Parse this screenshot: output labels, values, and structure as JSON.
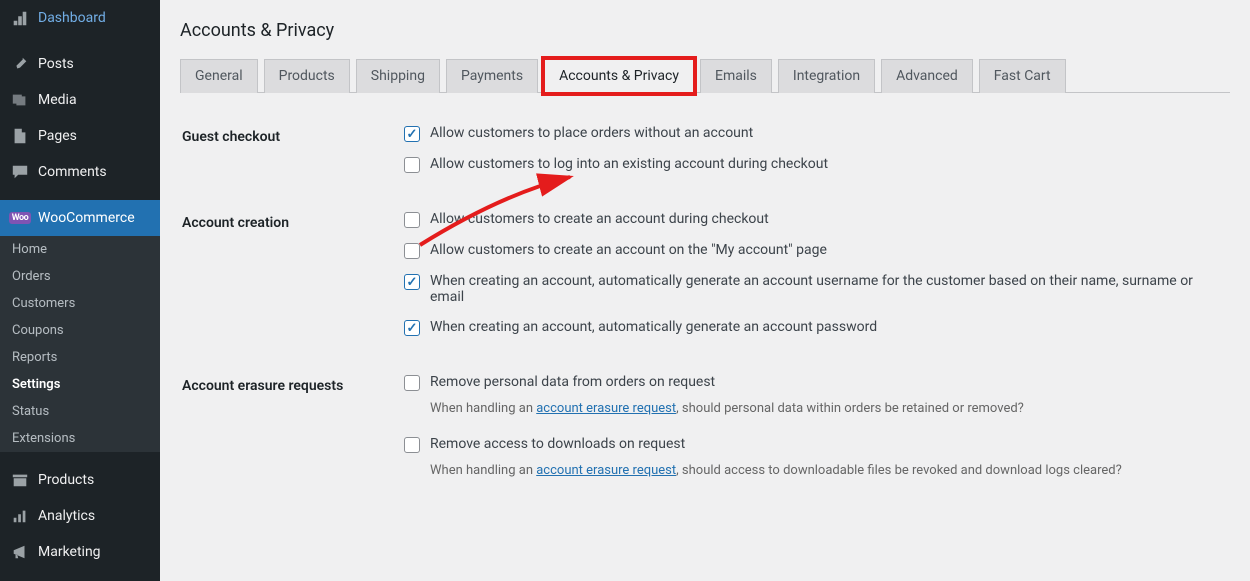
{
  "sidebar": {
    "items": [
      {
        "label": "Dashboard",
        "icon": "dashboard"
      },
      {
        "label": "Posts",
        "icon": "pin"
      },
      {
        "label": "Media",
        "icon": "media"
      },
      {
        "label": "Pages",
        "icon": "pages"
      },
      {
        "label": "Comments",
        "icon": "comment"
      },
      {
        "label": "WooCommerce",
        "icon": "woo",
        "current": true
      },
      {
        "label": "Products",
        "icon": "products"
      },
      {
        "label": "Analytics",
        "icon": "analytics"
      },
      {
        "label": "Marketing",
        "icon": "marketing"
      }
    ],
    "submenu": [
      "Home",
      "Orders",
      "Customers",
      "Coupons",
      "Reports",
      "Settings",
      "Status",
      "Extensions"
    ],
    "submenu_current": "Settings"
  },
  "page_title": "Accounts & Privacy",
  "tabs": [
    "General",
    "Products",
    "Shipping",
    "Payments",
    "Accounts & Privacy",
    "Emails",
    "Integration",
    "Advanced",
    "Fast Cart"
  ],
  "active_tab": "Accounts & Privacy",
  "sections": [
    {
      "heading": "Guest checkout",
      "options": [
        {
          "label": "Allow customers to place orders without an account",
          "checked": true,
          "extra_gap": false
        },
        {
          "label": "Allow customers to log into an existing account during checkout",
          "checked": false,
          "extra_gap": true
        }
      ]
    },
    {
      "heading": "Account creation",
      "options": [
        {
          "label": "Allow customers to create an account during checkout",
          "checked": false
        },
        {
          "label": "Allow customers to create an account on the \"My account\" page",
          "checked": false
        },
        {
          "label": "When creating an account, automatically generate an account username for the customer based on their name, surname or email",
          "checked": true
        },
        {
          "label": "When creating an account, automatically generate an account password",
          "checked": true,
          "extra_gap": true
        }
      ]
    },
    {
      "heading": "Account erasure requests",
      "options": [
        {
          "label": "Remove personal data from orders on request",
          "checked": false,
          "desc_pre": "When handling an ",
          "desc_link": "account erasure request",
          "desc_post": ", should personal data within orders be retained or removed?"
        },
        {
          "label": "Remove access to downloads on request",
          "checked": false,
          "desc_pre": "When handling an ",
          "desc_link": "account erasure request",
          "desc_post": ", should access to downloadable files be revoked and download logs cleared?"
        }
      ]
    }
  ]
}
